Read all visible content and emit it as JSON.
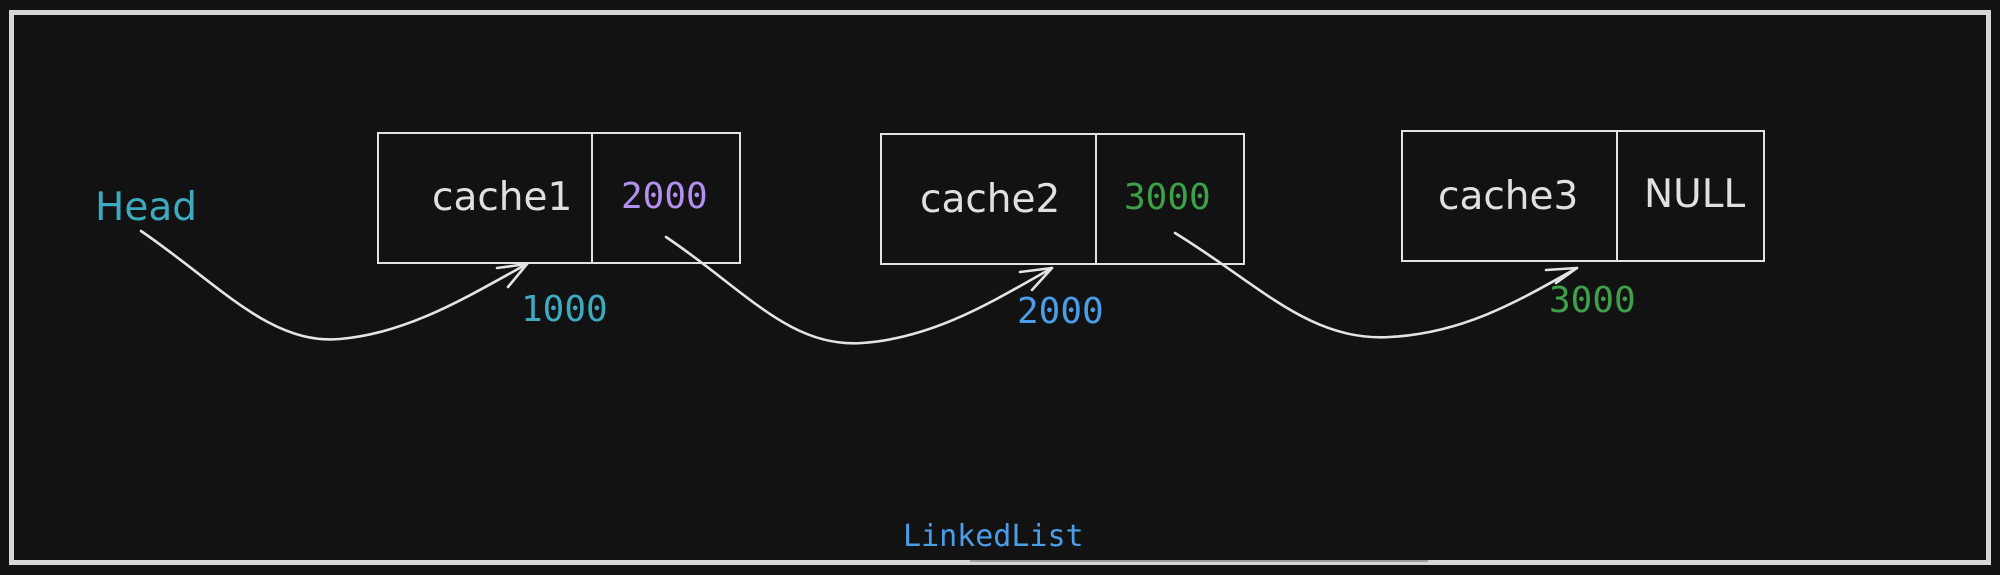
{
  "diagram": {
    "title": "LinkedList",
    "head_label": "Head",
    "colors": {
      "background": "#121212",
      "stroke": "#e2e2e2",
      "node_text": "#e0e0e0",
      "head": "#3caac0",
      "title": "#4a9de8"
    },
    "nodes": [
      {
        "name": "cache1",
        "next": "2000",
        "next_color": "#b38ff0",
        "address": "1000",
        "address_color": "#3caac0"
      },
      {
        "name": "cache2",
        "next": "3000",
        "next_color": "#3da14a",
        "address": "2000",
        "address_color": "#4a9de8"
      },
      {
        "name": "cache3",
        "next": "NULL",
        "next_color": "#e0e0e0",
        "address": "3000",
        "address_color": "#3da14a"
      }
    ]
  }
}
